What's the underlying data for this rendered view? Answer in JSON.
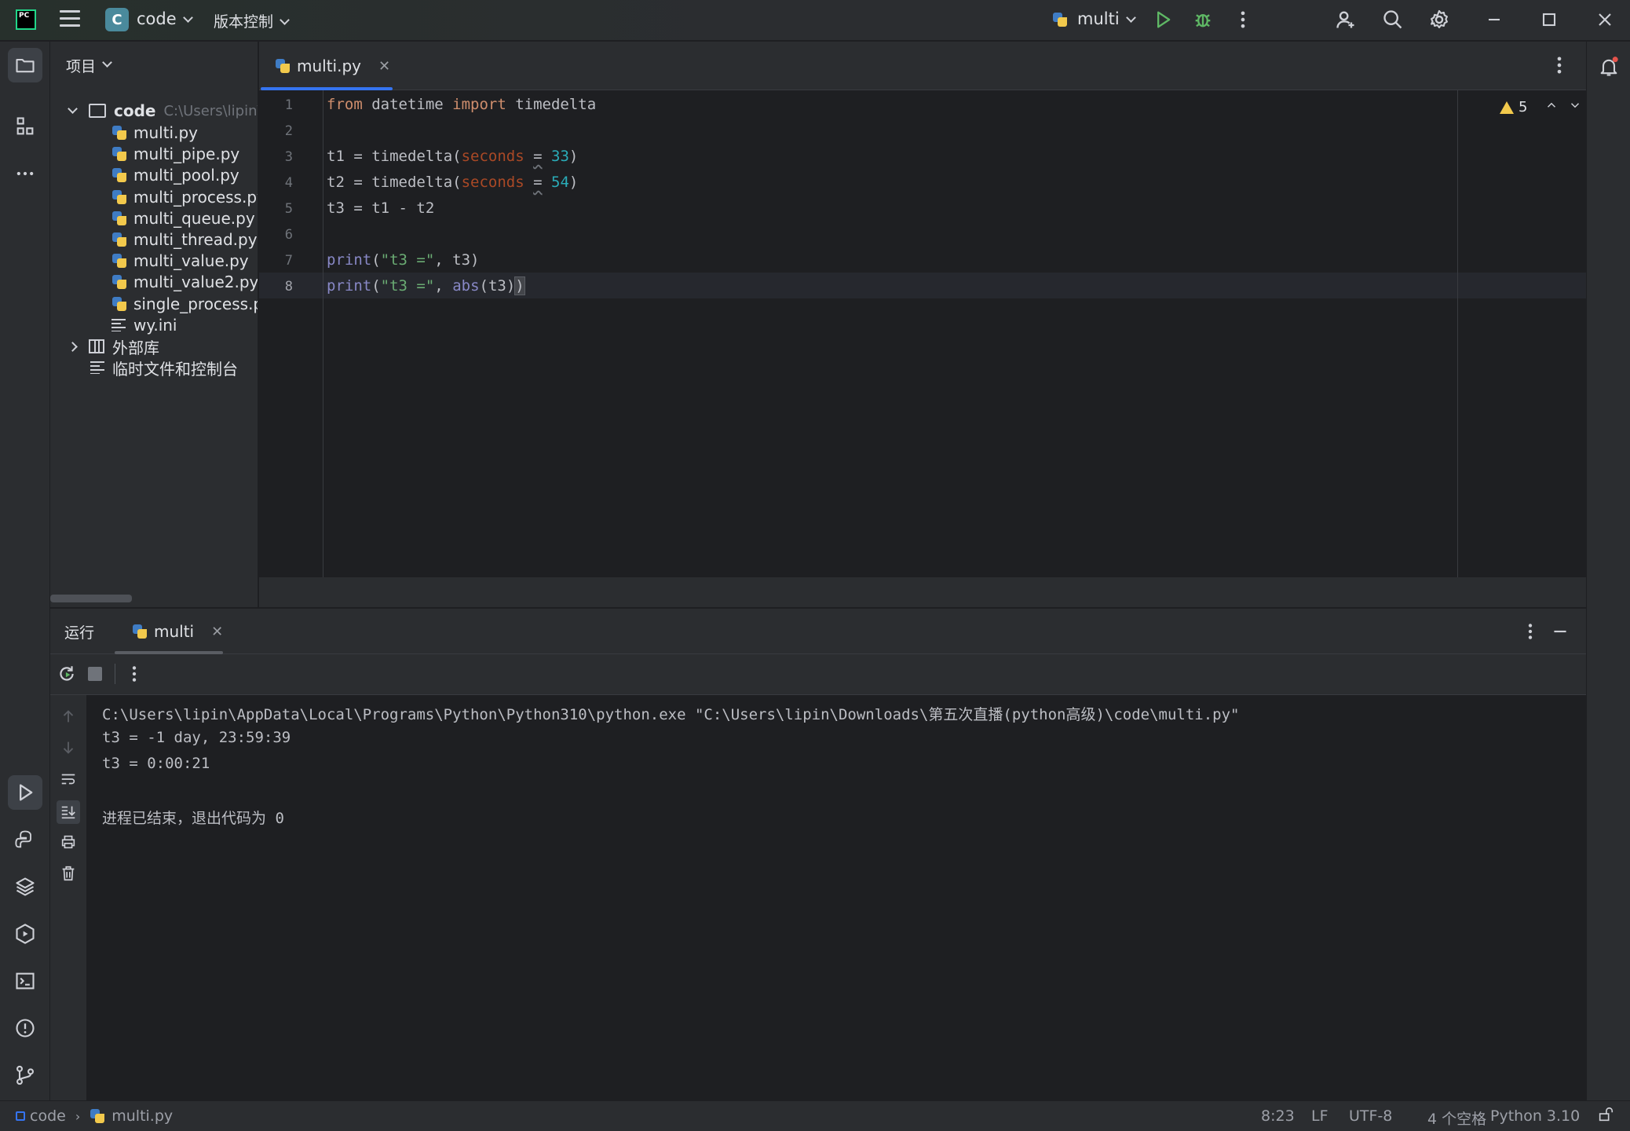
{
  "titlebar": {
    "project_badge": "C",
    "project_name": "code",
    "vcs_menu": "版本控制",
    "run_config": "multi"
  },
  "project_panel": {
    "header": "项目",
    "root": {
      "name": "code",
      "path": "C:\\Users\\lipin\\"
    },
    "files": [
      {
        "name": "multi.py",
        "type": "python"
      },
      {
        "name": "multi_pipe.py",
        "type": "python"
      },
      {
        "name": "multi_pool.py",
        "type": "python"
      },
      {
        "name": "multi_process.py",
        "type": "python"
      },
      {
        "name": "multi_queue.py",
        "type": "python"
      },
      {
        "name": "multi_thread.py",
        "type": "python"
      },
      {
        "name": "multi_value.py",
        "type": "python"
      },
      {
        "name": "multi_value2.py",
        "type": "python"
      },
      {
        "name": "single_process.py",
        "type": "python"
      },
      {
        "name": "wy.ini",
        "type": "text"
      }
    ],
    "external_libs": "外部库",
    "scratches": "临时文件和控制台"
  },
  "editor": {
    "tab_label": "multi.py",
    "warning_count": "5",
    "line_numbers": [
      "1",
      "2",
      "3",
      "4",
      "5",
      "6",
      "7",
      "8"
    ],
    "current_line": "8"
  },
  "run_panel": {
    "title": "运行",
    "tab_label": "multi",
    "console_lines": [
      "C:\\Users\\lipin\\AppData\\Local\\Programs\\Python\\Python310\\python.exe \"C:\\Users\\lipin\\Downloads\\第五次直播(python高级)\\code\\multi.py\"",
      "t3 = -1 day, 23:59:39",
      "t3 = 0:00:21",
      "",
      "进程已结束，退出代码为 0"
    ]
  },
  "statusbar": {
    "breadcrumb_project": "code",
    "breadcrumb_file": "multi.py",
    "position": "8:23",
    "line_sep": "LF",
    "encoding": "UTF-8",
    "indent": "4 个空格",
    "interpreter": "Python 3.10"
  },
  "colors": {
    "accent": "#3574f0",
    "run_green": "#5fb865",
    "keyword": "#cf8e6d",
    "string": "#6aab73",
    "number": "#2aacb8",
    "param": "#aa4926",
    "builtin": "#8888c6"
  }
}
